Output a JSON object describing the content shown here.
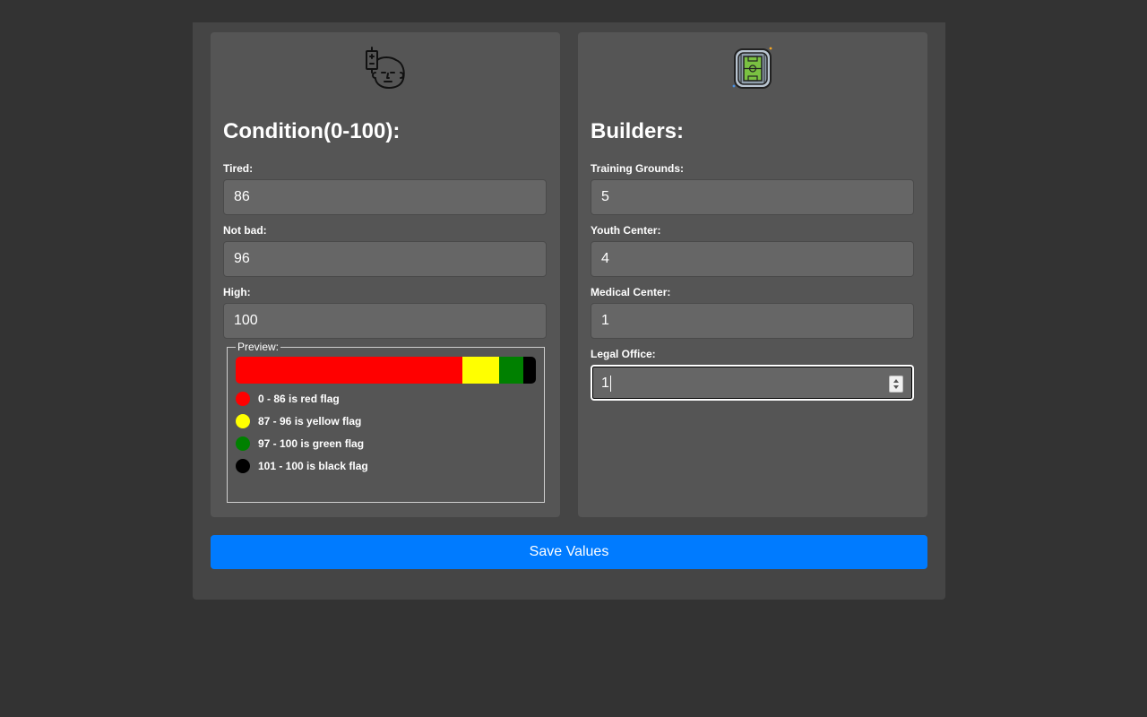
{
  "condition": {
    "title": "Condition(0-100):",
    "icon": "tired-face-battery-icon",
    "fields": [
      {
        "label": "Tired:",
        "value": "86"
      },
      {
        "label": "Not bad:",
        "value": "96"
      },
      {
        "label": "High:",
        "value": "100"
      }
    ],
    "preview": {
      "legend": "Preview:",
      "bar_segments": [
        {
          "color": "#ff0000",
          "share": 0.755
        },
        {
          "color": "#ffff00",
          "share": 0.123
        },
        {
          "color": "#008000",
          "share": 0.08
        },
        {
          "color": "#000000",
          "share": 0.042
        }
      ],
      "items": [
        {
          "color": "#ff0000",
          "text": "0 - 86 is red flag"
        },
        {
          "color": "#ffff00",
          "text": "87 - 96 is yellow flag"
        },
        {
          "color": "#008000",
          "text": "97 - 100 is green flag"
        },
        {
          "color": "#000000",
          "text": "101 - 100 is black flag"
        }
      ]
    }
  },
  "builders": {
    "title": "Builders:",
    "icon": "stadium-icon",
    "fields": [
      {
        "label": "Training Grounds:",
        "value": "5"
      },
      {
        "label": "Youth Center:",
        "value": "4"
      },
      {
        "label": "Medical Center:",
        "value": "1"
      },
      {
        "label": "Legal Office:",
        "value": "1"
      }
    ]
  },
  "save_button": "Save Values",
  "colors": {
    "accent": "#007bff",
    "panel": "#555555",
    "background": "#333333"
  }
}
